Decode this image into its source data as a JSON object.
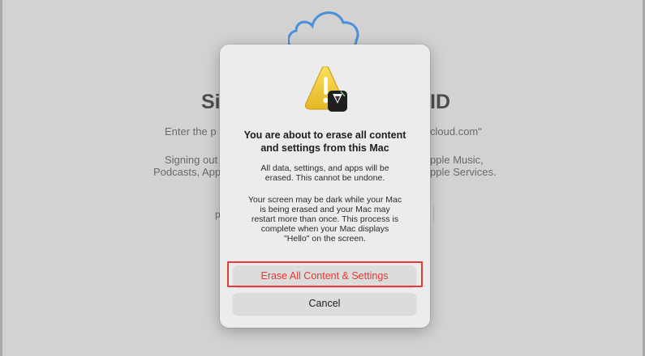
{
  "background": {
    "title_left": "Si",
    "title_right": "ID",
    "line1_left": "Enter the p",
    "line1_right": "cloud.com\"",
    "line2_left": "Signing out",
    "line2_right": "pple Music,",
    "line3_left": "Podcasts, App",
    "line3_right": "pple Services.",
    "field_fragment": "p"
  },
  "dialog": {
    "icon": "warning-with-tuxedo-icon",
    "title_lines": [
      "You are about to erase all content",
      "and settings from this Mac"
    ],
    "message1_lines": [
      "All data, settings, and apps will be",
      "erased. This cannot be undone."
    ],
    "message2_lines": [
      "Your screen may be dark while your Mac",
      "is being erased and your Mac may",
      "restart more than once. This process is",
      "complete when your Mac displays",
      "\"Hello\" on the screen."
    ],
    "erase_button": "Erase All Content & Settings",
    "cancel_button": "Cancel"
  },
  "colors": {
    "erase_text": "#e03a33",
    "highlight": "#e5393a",
    "cloud": "#4a90d9"
  }
}
